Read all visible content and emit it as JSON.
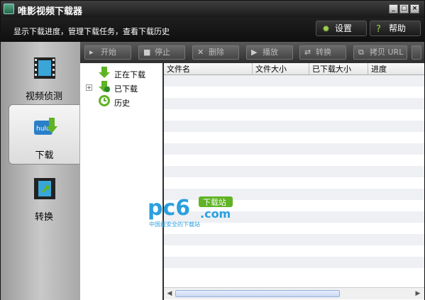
{
  "window": {
    "title": "唯影视频下载器",
    "min": "_",
    "max": "□",
    "close": "×"
  },
  "infobar": {
    "description": "显示下载进度，管理下载任务，查看下载历史",
    "settings": "设置",
    "help": "帮助"
  },
  "nav": [
    {
      "label": "视频侦测",
      "icon": "film-icon"
    },
    {
      "label": "下载",
      "icon": "download-icon"
    },
    {
      "label": "转换",
      "icon": "convert-icon"
    }
  ],
  "toolbar": [
    "开始",
    "停止",
    "删除",
    "播放",
    "转换",
    "拷贝 URL"
  ],
  "tree": [
    {
      "label": "正在下载",
      "expander": ""
    },
    {
      "label": "已下载",
      "expander": "+"
    },
    {
      "label": "历史",
      "expander": ""
    }
  ],
  "columns": [
    "文件名",
    "文件大小",
    "已下载大小",
    "进度"
  ],
  "watermark": {
    "brand": "pc6",
    "tag": "下载站",
    "domain": ".com",
    "slogan": "中国最安全的下载站"
  },
  "colors": {
    "accent_green": "#5fb324",
    "selected_nav": "#f0f0f0",
    "watermark_blue": "#2aa0e0"
  }
}
